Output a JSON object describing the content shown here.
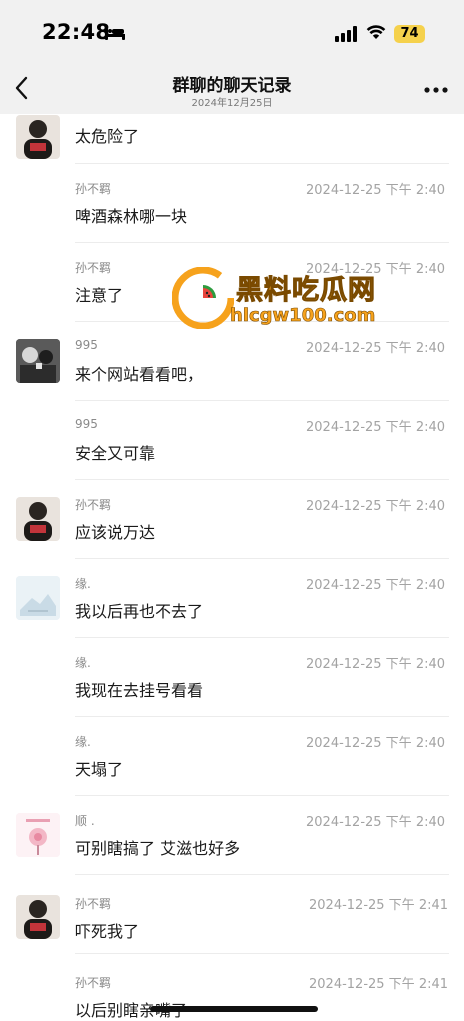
{
  "status": {
    "time": "22:48",
    "battery": "74"
  },
  "nav": {
    "title": "群聊的聊天记录",
    "subtitle": "2024年12月25日"
  },
  "messages": [
    {
      "sender": "",
      "time": "",
      "text": "太危险了"
    },
    {
      "sender": "孙不羁",
      "time": "2024-12-25 下午 2:40",
      "text": "啤酒森林哪一块"
    },
    {
      "sender": "孙不羁",
      "time": "2024-12-25 下午 2:40",
      "text": "注意了"
    },
    {
      "sender": "995",
      "time": "2024-12-25 下午 2:40",
      "text": "来个网站看看吧，"
    },
    {
      "sender": "995",
      "time": "2024-12-25 下午 2:40",
      "text": "安全又可靠"
    },
    {
      "sender": "孙不羁",
      "time": "2024-12-25 下午 2:40",
      "text": "应该说万达"
    },
    {
      "sender": "缘.",
      "time": "2024-12-25 下午 2:40",
      "text": "我以后再也不去了"
    },
    {
      "sender": "缘.",
      "time": "2024-12-25 下午 2:40",
      "text": "我现在去挂号看看"
    },
    {
      "sender": "缘.",
      "time": "2024-12-25 下午 2:40",
      "text": "天塌了"
    },
    {
      "sender": "顺 .",
      "time": "2024-12-25 下午 2:40",
      "text": "可别瞎搞了 艾滋也好多"
    },
    {
      "sender": "孙不羁",
      "time": "2024-12-25 下午 2:41",
      "text": "吓死我了"
    },
    {
      "sender": "孙不羁",
      "time": "2024-12-25 下午 2:41",
      "text": "以后别瞎亲嘴了"
    }
  ],
  "watermark": {
    "title": "黑料吃瓜网",
    "url": "hlcgw100.com"
  },
  "icons": {
    "back": "chevron-left-icon",
    "more": "more-dots-icon",
    "signal": "cellular-signal-icon",
    "wifi": "wifi-icon",
    "battery": "battery-icon",
    "bed": "sleep-focus-icon"
  }
}
